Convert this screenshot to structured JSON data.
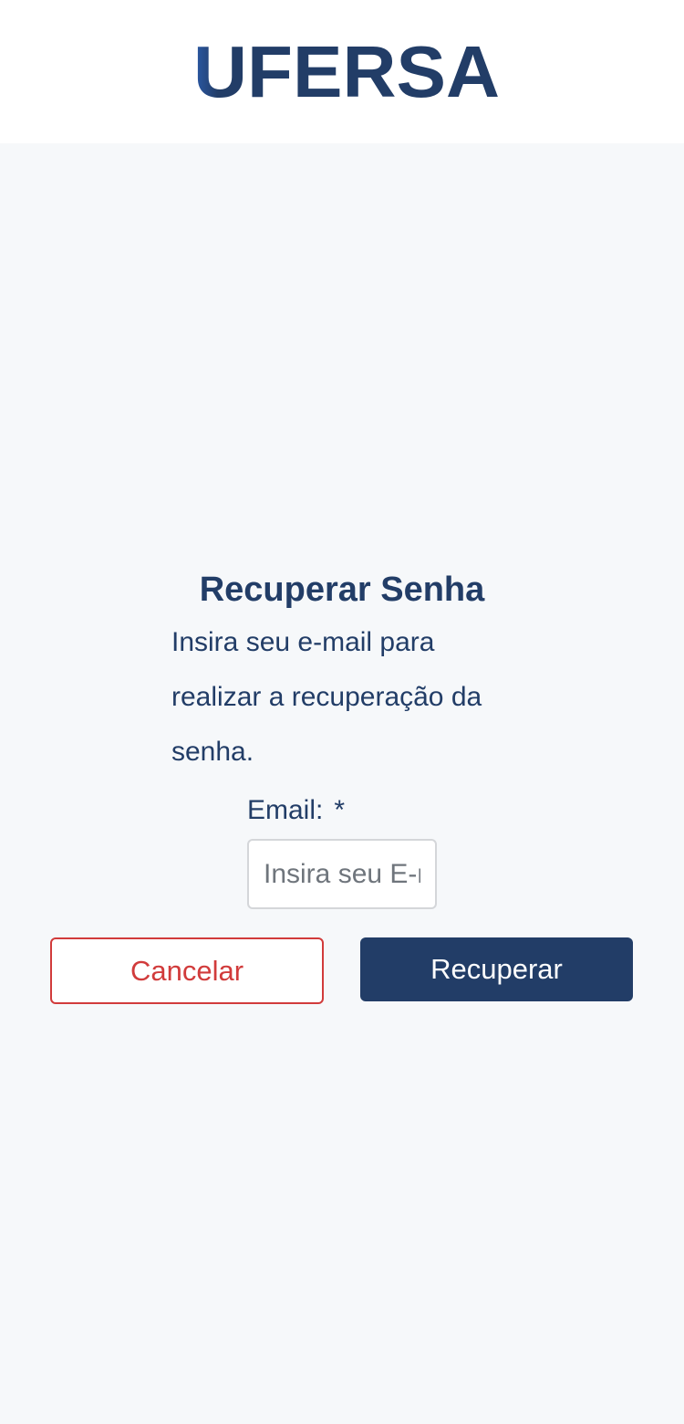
{
  "header": {
    "logo_text": "UFERSA"
  },
  "form": {
    "title": "Recuperar Senha",
    "description": "Insira seu e-mail para realizar a recuperação da senha.",
    "email_label": "Email:",
    "required_marker": "*",
    "email_value": "",
    "email_placeholder": "Insira seu E-mail"
  },
  "buttons": {
    "cancel_label": "Cancelar",
    "recover_label": "Recuperar"
  },
  "colors": {
    "primary": "#223d67",
    "danger": "#d13b3b",
    "background": "#f6f8fa"
  }
}
